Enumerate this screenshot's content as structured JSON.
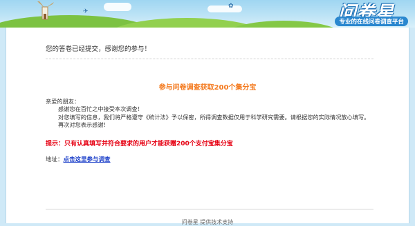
{
  "header": {
    "logo_text": "问卷星",
    "slogan": "专业的在线问卷调查平台"
  },
  "main": {
    "thanks_message": "您的答卷已经提交，感谢您的参与！",
    "promo_title": "参与问卷调查获取200个集分宝",
    "letter": {
      "greeting": "亲爱的朋友：",
      "line1": "感谢您在百忙之中接受本次调查！",
      "line2": "对您填写的信息，我们将严格遵守《统计法》予以保密，所得调查数据仅用于科学研究需要。请根据您的实际情况放心填写。",
      "line3": "再次对您表示感谢！"
    },
    "tip": "提示：只有认真填写并符合要求的用户才能获赠200个支付宝集分宝",
    "address_label": "地址：",
    "address_link": "点击这里参与调查"
  },
  "footer": {
    "text": "问卷星 提供技术支持"
  },
  "colors": {
    "promo": "#f47a1f",
    "tip": "#e60012",
    "link": "#1a3ec9"
  }
}
